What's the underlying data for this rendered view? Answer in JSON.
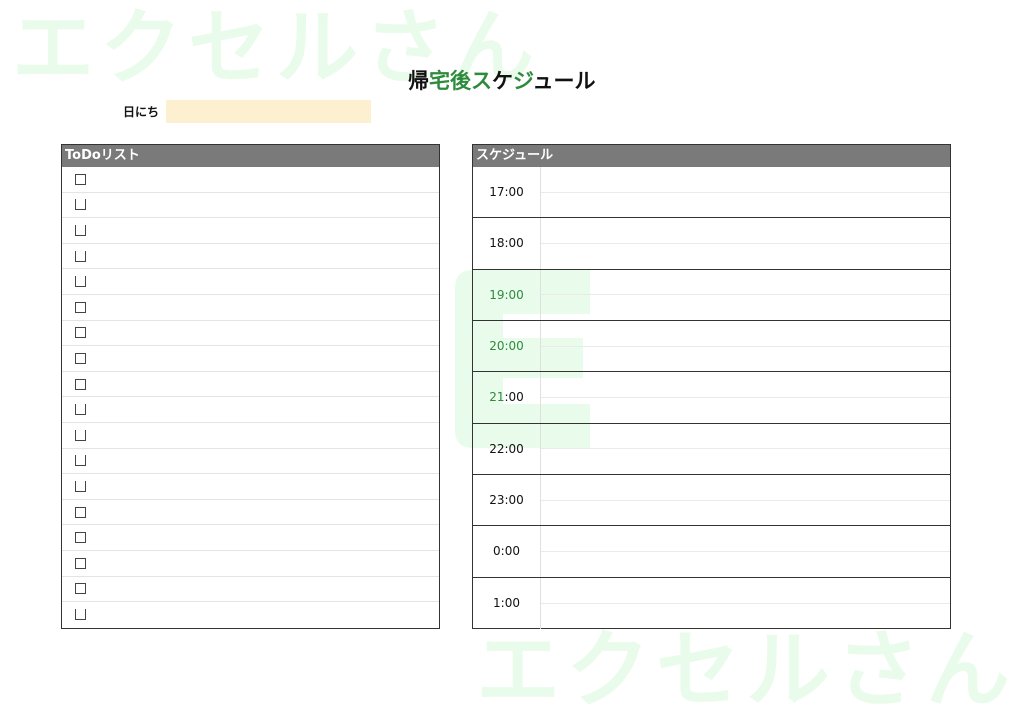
{
  "watermark": {
    "text": "エクセルさん"
  },
  "header": {
    "title_part1": "帰",
    "title_part2": "宅後",
    "title_part3": "ス",
    "title_part4": "ケ",
    "title_part5": "ジ",
    "title_part6": "ュール",
    "date_label": "日にち",
    "date_value": ""
  },
  "todo": {
    "heading": "ToDoリスト",
    "items": [
      {
        "checkbox": "closed"
      },
      {
        "checkbox": "open"
      },
      {
        "checkbox": "open"
      },
      {
        "checkbox": "open"
      },
      {
        "checkbox": "open"
      },
      {
        "checkbox": "closed"
      },
      {
        "checkbox": "closed"
      },
      {
        "checkbox": "closed"
      },
      {
        "checkbox": "closed"
      },
      {
        "checkbox": "open"
      },
      {
        "checkbox": "open"
      },
      {
        "checkbox": "open"
      },
      {
        "checkbox": "open"
      },
      {
        "checkbox": "closed"
      },
      {
        "checkbox": "closed"
      },
      {
        "checkbox": "closed"
      },
      {
        "checkbox": "closed"
      },
      {
        "checkbox": "open"
      }
    ]
  },
  "schedule": {
    "heading": "スケジュール",
    "slots": [
      {
        "time": "17:00"
      },
      {
        "time": "18:00"
      },
      {
        "time": "19:00"
      },
      {
        "time": "20:00"
      },
      {
        "time": "21:00"
      },
      {
        "time": "22:00"
      },
      {
        "time": "23:00"
      },
      {
        "time": "0:00"
      },
      {
        "time": "1:00"
      }
    ]
  },
  "colors": {
    "accent_green": "#2e8b3e",
    "header_gray": "#7a7a7a",
    "date_fill": "#fdf0d0",
    "watermark": "#e9fbea"
  }
}
